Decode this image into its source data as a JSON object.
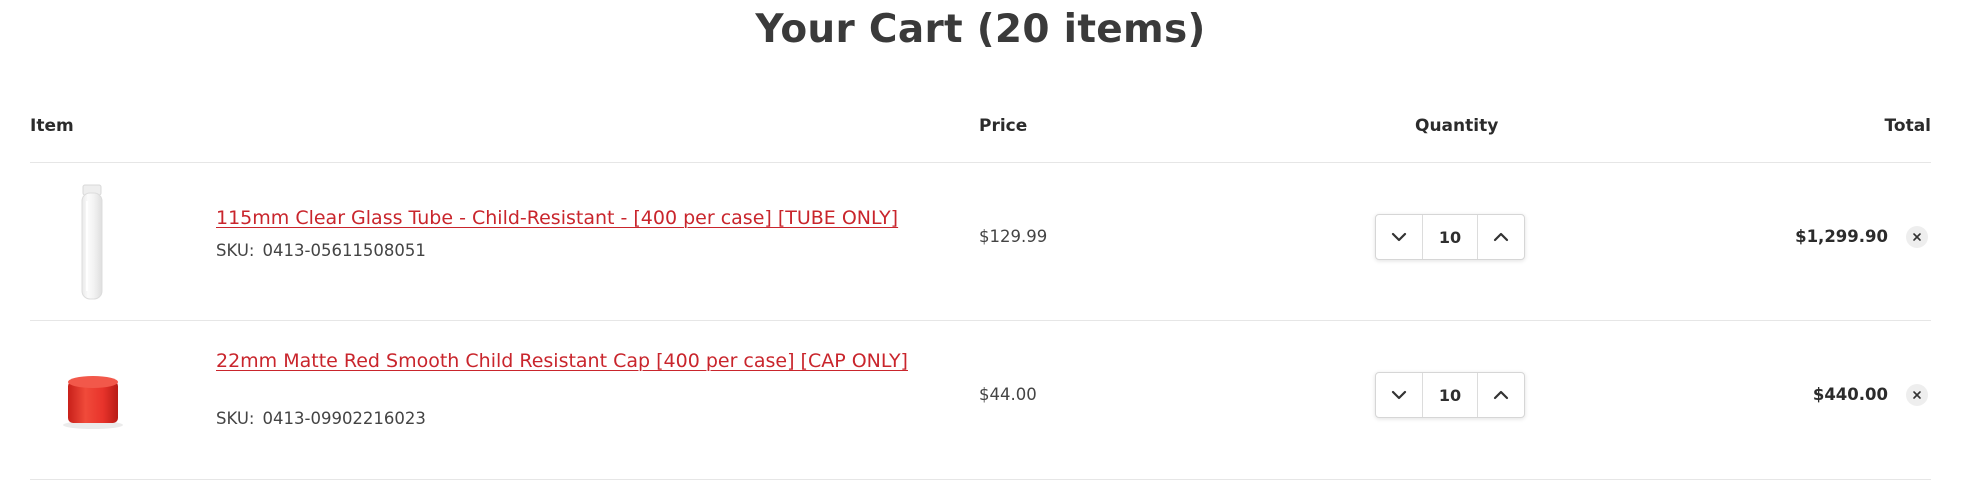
{
  "page": {
    "title": "Your Cart (20 items)"
  },
  "table": {
    "headers": {
      "item": "Item",
      "price": "Price",
      "quantity": "Quantity",
      "total": "Total"
    }
  },
  "items": [
    {
      "name": "115mm Clear Glass Tube - Child-Resistant - [400 per case] [TUBE ONLY]",
      "sku_label": "SKU:",
      "sku": "0413-05611508051",
      "price": "$129.99",
      "quantity": "10",
      "total": "$1,299.90",
      "thumbnail": "clear-glass-tube"
    },
    {
      "name": "22mm Matte Red Smooth Child Resistant Cap [400 per case] [CAP ONLY]",
      "sku_label": "SKU:",
      "sku": "0413-09902216023",
      "price": "$44.00",
      "quantity": "10",
      "total": "$440.00",
      "thumbnail": "red-cap"
    }
  ],
  "colors": {
    "link": "#c9252c",
    "divider": "#e6e6e6",
    "cap_red": "#e8332b"
  },
  "icons": {
    "decrease": "chevron-down-icon",
    "increase": "chevron-up-icon",
    "remove": "close-icon"
  }
}
